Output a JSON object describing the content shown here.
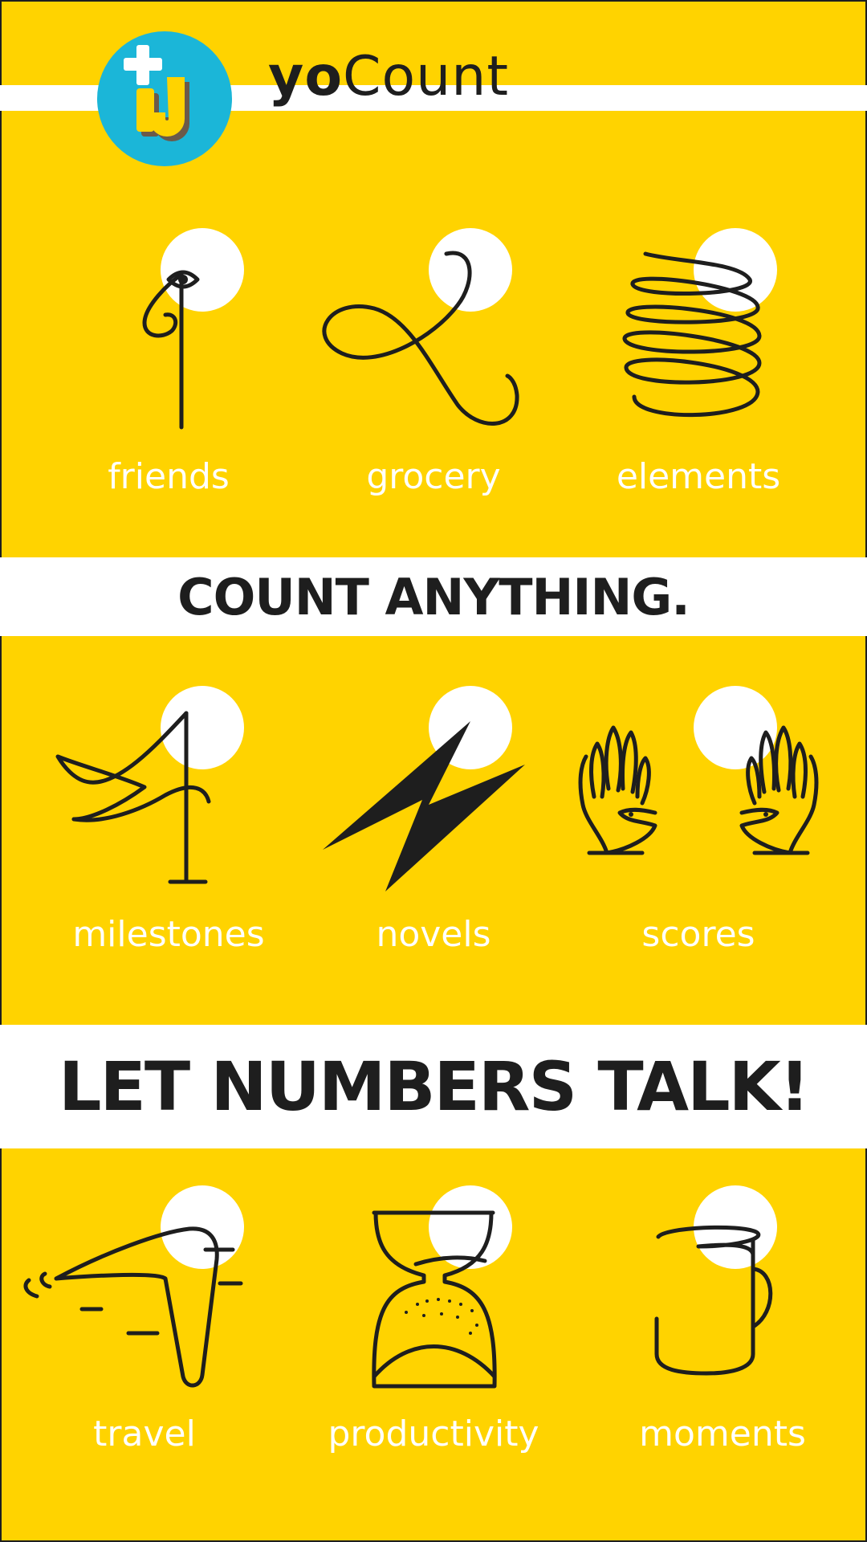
{
  "app": {
    "name_prefix": "yo",
    "name_suffix": "Count"
  },
  "taglines": {
    "first": "COUNT ANYTHING.",
    "second": "LET NUMBERS TALK!"
  },
  "categories": [
    {
      "label": "friends",
      "icon": "eye-one-icon"
    },
    {
      "label": "grocery",
      "icon": "loop-two-icon"
    },
    {
      "label": "elements",
      "icon": "spring-coil-icon"
    },
    {
      "label": "milestones",
      "icon": "flag-hammock-icon"
    },
    {
      "label": "novels",
      "icon": "lightning-bolt-icon"
    },
    {
      "label": "scores",
      "icon": "clapping-hands-icon"
    },
    {
      "label": "travel",
      "icon": "airplane-seven-icon"
    },
    {
      "label": "productivity",
      "icon": "hourglass-icon"
    },
    {
      "label": "moments",
      "icon": "mug-icon"
    }
  ],
  "colors": {
    "background": "#FFD300",
    "band": "#FFFFFF",
    "ink": "#1E1E1E",
    "logo_blue": "#1BB6D8",
    "logo_yellow": "#FFD300"
  }
}
